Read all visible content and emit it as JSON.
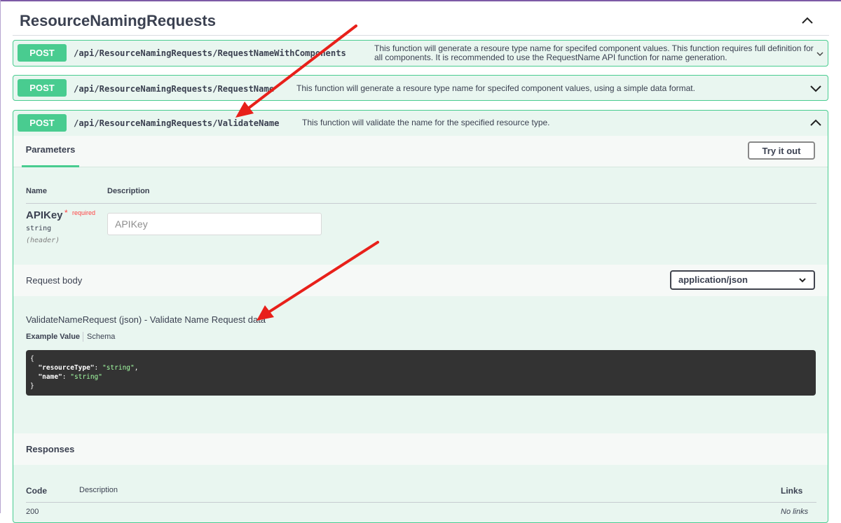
{
  "section": {
    "title": "ResourceNamingRequests"
  },
  "operations": [
    {
      "method": "POST",
      "path": "/api/ResourceNamingRequests/RequestNameWithComponents",
      "description": "This function will generate a resoure type name for specifed component values. This function requires full definition for all components. It is recommended to use the RequestName API function for name generation."
    },
    {
      "method": "POST",
      "path": "/api/ResourceNamingRequests/RequestName",
      "description": "This function will generate a resoure type name for specifed component values, using a simple data format."
    },
    {
      "method": "POST",
      "path": "/api/ResourceNamingRequests/ValidateName",
      "description": "This function will validate the name for the specified resource type."
    }
  ],
  "expanded": {
    "parameters_tab": "Parameters",
    "try_it_out": "Try it out",
    "columns": {
      "name": "Name",
      "description": "Description"
    },
    "param": {
      "name": "APIKey",
      "required_star": "*",
      "required_text": "required",
      "type": "string",
      "in": "(header)",
      "placeholder": "APIKey"
    },
    "request_body": {
      "label": "Request body",
      "content_type": "application/json",
      "model_title": "ValidateNameRequest (json) - Validate Name Request data",
      "example_tab": "Example Value",
      "schema_tab": "Schema",
      "example": {
        "open": "{",
        "key1": "\"resourceType\"",
        "val1": "\"string\"",
        "key2": "\"name\"",
        "val2": "\"string\"",
        "close": "}"
      }
    },
    "responses": {
      "title": "Responses",
      "code_col": "Code",
      "desc_col": "Description",
      "links_col": "Links",
      "first_code": "200",
      "first_links": "No links"
    }
  },
  "colors": {
    "post": "#49cc90",
    "post_bg": "#e9f6f0",
    "arrow": "#e8201a",
    "header_accent": "#7d5aa6"
  }
}
